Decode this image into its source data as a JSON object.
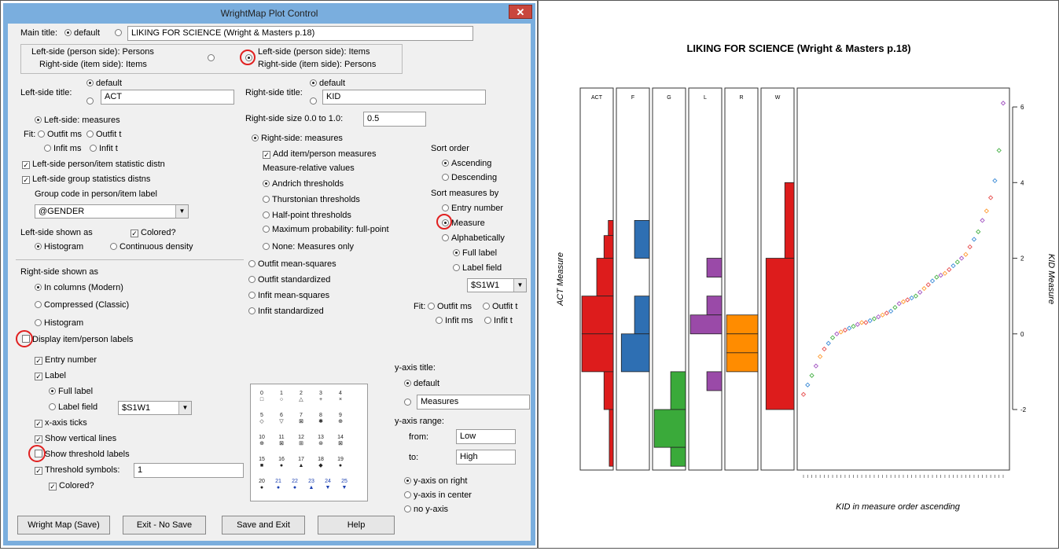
{
  "dialog": {
    "title": "WrightMap Plot Control",
    "close": "✕",
    "main_title_label": "Main title:",
    "main_title_default": "default",
    "main_title_value": "LIKING FOR SCIENCE (Wright & Masters p.18)",
    "side_opt1_line1": "Left-side (person side): Persons",
    "side_opt1_line2": "Right-side (item side): Items",
    "side_opt2_line1": "Left-side (person side): Items",
    "side_opt2_line2": "Right-side (item side): Persons",
    "left_title_label": "Left-side title:",
    "left_title_default": "default",
    "left_title_value": "ACT",
    "right_title_label": "Right-side title:",
    "right_title_default": "default",
    "right_title_value": "KID",
    "left_measures": "Left-side: measures",
    "fit_label": "Fit:",
    "outfit_ms": "Outfit ms",
    "outfit_t": "Outfit t",
    "infit_ms": "Infit ms",
    "infit_t": "Infit t",
    "left_stat_distn": "Left-side person/item statistic distn",
    "left_group_stats": "Left-side group statistics distns",
    "group_code_label": "Group code in person/item label",
    "group_code_value": "@GENDER",
    "left_shown_as": "Left-side shown as",
    "colored": "Colored?",
    "histogram": "Histogram",
    "continuous_density": "Continuous density",
    "right_size_label": "Right-side size 0.0 to 1.0:",
    "right_size_value": "0.5",
    "right_measures": "Right-side: measures",
    "add_measures": "Add item/person measures",
    "measure_relative": "Measure-relative values",
    "andrich": "Andrich thresholds",
    "thurstonian": "Thurstonian thresholds",
    "half_point": "Half-point thresholds",
    "max_prob": "Maximum probability: full-point",
    "none_measures": "None: Measures only",
    "outfit_mean_squares": "Outfit mean-squares",
    "outfit_standardized": "Outfit standardized",
    "infit_mean_squares": "Infit mean-squares",
    "infit_standardized": "Infit standardized",
    "sort_order": "Sort order",
    "ascending": "Ascending",
    "descending": "Descending",
    "sort_measures_by": "Sort measures by",
    "entry_number": "Entry number",
    "measure": "Measure",
    "alphabetically": "Alphabetically",
    "full_label": "Full label",
    "label_field": "Label field",
    "label_field_value": "$S1W1",
    "fit_label2": "Fit:",
    "outfit_ms2": "Outfit ms",
    "outfit_t2": "Outfit t",
    "infit_ms2": "Infit ms",
    "infit_t2": "Infit t",
    "right_shown_as": "Right-side shown as",
    "in_columns": "In columns (Modern)",
    "compressed": "Compressed (Classic)",
    "histogram2": "Histogram",
    "display_labels": "Display item/person labels",
    "entry_number2": "Entry number",
    "label": "Label",
    "full_label2": "Full label",
    "label_field2": "Label field",
    "label_field_value2": "$S1W1",
    "xaxis_ticks": "x-axis ticks",
    "show_vertical": "Show vertical lines",
    "show_threshold": "Show threshold labels",
    "threshold_symbols": "Threshold symbols:",
    "threshold_symbols_value": "1",
    "colored2": "Colored?",
    "yaxis_title": "y-axis title:",
    "yaxis_default": "default",
    "yaxis_value": "Measures",
    "yaxis_range": "y-axis range:",
    "from": "from:",
    "from_value": "Low",
    "to": "to:",
    "to_value": "High",
    "yaxis_right": "y-axis on right",
    "yaxis_center": "y-axis in center",
    "no_yaxis": "no y-axis",
    "btn_wright": "Wright Map (Save)",
    "btn_exit": "Exit - No Save",
    "btn_save_exit": "Save and Exit",
    "btn_help": "Help",
    "symbol_numbers": [
      "0",
      "1",
      "2",
      "3",
      "4",
      "5",
      "6",
      "7",
      "8",
      "9",
      "10",
      "11",
      "12",
      "13",
      "14",
      "15",
      "16",
      "17",
      "18",
      "19",
      "20",
      "21",
      "22",
      "23",
      "24",
      "25"
    ]
  },
  "chart_data": {
    "type": "histogram",
    "title": "LIKING FOR SCIENCE (Wright & Masters p.18)",
    "ylabel_left": "ACT Measure",
    "ylabel_right": "KID Measure",
    "xlabel": "KID in measure order ascending",
    "ylim": [
      -3.6,
      6.5
    ],
    "yticks": [
      "-2",
      "0",
      "2",
      "4",
      "6"
    ],
    "panels": [
      {
        "label": "ACT",
        "color": "#dd1c1c"
      },
      {
        "label": "F",
        "color": "#2e6fb3"
      },
      {
        "label": "G",
        "color": "#3aaa3a"
      },
      {
        "label": "L",
        "color": "#9a4aa8"
      },
      {
        "label": "R",
        "color": "#ff8c00"
      },
      {
        "label": "W",
        "color": "#dd1c1c"
      }
    ],
    "person_points": [
      -1.6,
      -1.35,
      -1.1,
      -0.85,
      -0.6,
      -0.4,
      -0.25,
      -0.1,
      0.0,
      0.05,
      0.1,
      0.15,
      0.2,
      0.25,
      0.3,
      0.3,
      0.35,
      0.4,
      0.45,
      0.5,
      0.55,
      0.6,
      0.7,
      0.8,
      0.85,
      0.9,
      0.95,
      1.0,
      1.1,
      1.2,
      1.3,
      1.4,
      1.5,
      1.55,
      1.6,
      1.7,
      1.8,
      1.9,
      2.0,
      2.1,
      2.3,
      2.5,
      2.7,
      3.0,
      3.25,
      3.6,
      4.05,
      4.85,
      6.1
    ]
  }
}
